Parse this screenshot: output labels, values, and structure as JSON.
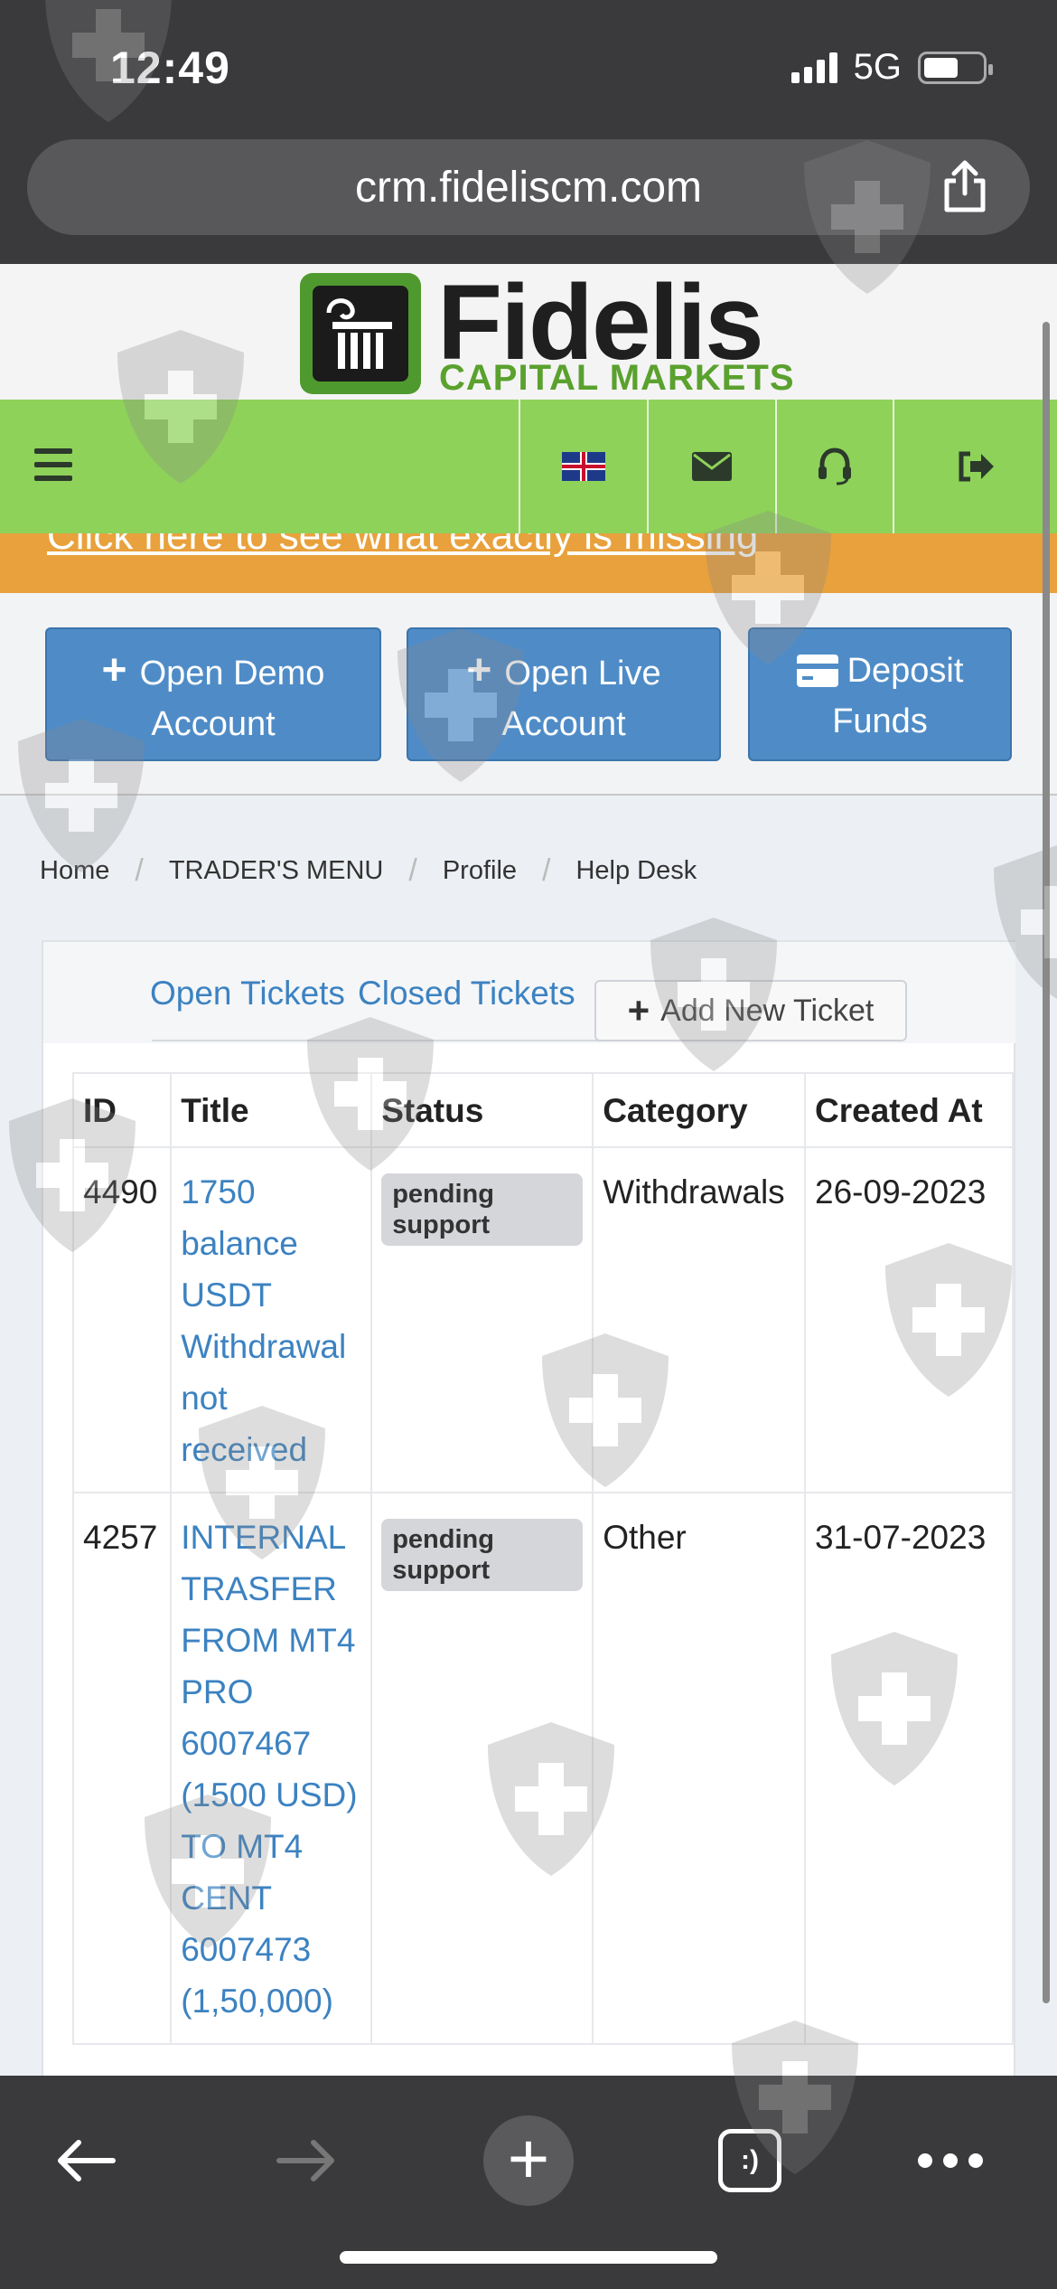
{
  "status_bar": {
    "time": "12:49",
    "network": "5G"
  },
  "browser": {
    "url": "crm.fideliscm.com"
  },
  "brand": {
    "name": "Fidelis",
    "sub": "CAPITAL MARKETS"
  },
  "notice": {
    "text": "Click here to see what exactly is missing"
  },
  "actions": {
    "open_demo": "Open Demo Account",
    "open_live": "Open Live Account",
    "deposit": "Deposit Funds"
  },
  "breadcrumb": [
    "Home",
    "TRADER'S MENU",
    "Profile",
    "Help Desk"
  ],
  "tickets": {
    "tab_open": "Open Tickets",
    "tab_closed": "Closed Tickets",
    "add_new": "Add New Ticket",
    "columns": [
      "ID",
      "Title",
      "Status",
      "Category",
      "Created At"
    ],
    "rows": [
      {
        "id": "4490",
        "title": "1750 balance USDT Withdrawal not received",
        "status": "pending support",
        "category": "Withdrawals",
        "created": "26-09-2023"
      },
      {
        "id": "4257",
        "title": "INTERNAL TRASFER FROM MT4 PRO 6007467 (1500 USD) TO MT4 CENT 6007473 (1,50,000)",
        "status": "pending support",
        "category": "Other",
        "created": "31-07-2023"
      }
    ]
  },
  "bottom_bar": {
    "tab_count": ":)"
  },
  "colors": {
    "nav_green": "#8ed25a",
    "notice_orange": "#e8a13c",
    "button_blue": "#4f8cc7",
    "link_blue": "#3c82c1"
  }
}
